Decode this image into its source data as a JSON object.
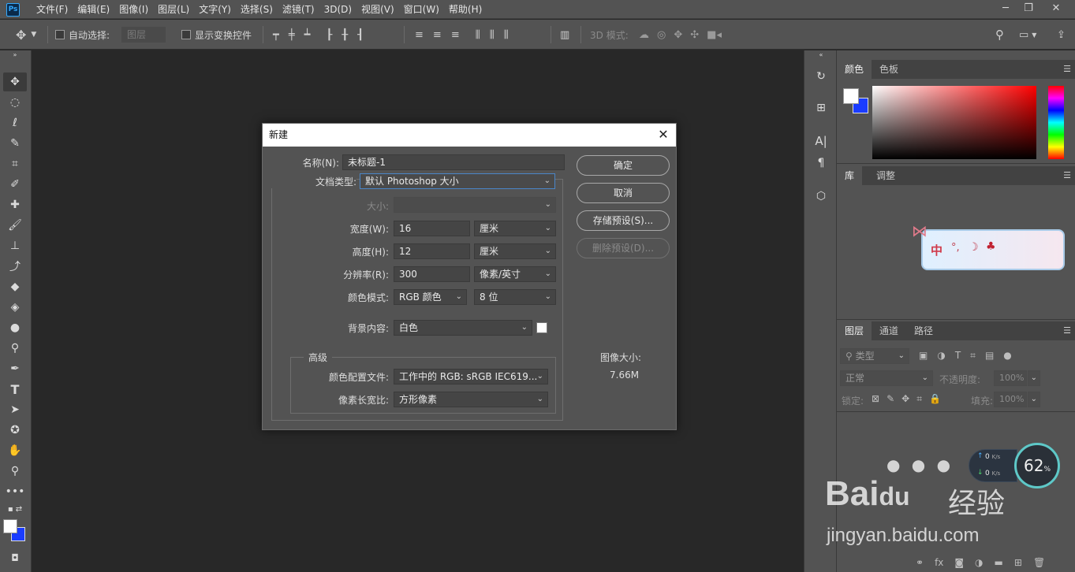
{
  "app": {
    "logo_text": "Ps"
  },
  "menu": [
    "文件(F)",
    "编辑(E)",
    "图像(I)",
    "图层(L)",
    "文字(Y)",
    "选择(S)",
    "滤镜(T)",
    "3D(D)",
    "视图(V)",
    "窗口(W)",
    "帮助(H)"
  ],
  "window_controls": {
    "minimize": "─",
    "restore": "❐",
    "close": "✕"
  },
  "options": {
    "auto_select_label": "自动选择:",
    "auto_select_target": "图层",
    "show_transform_label": "显示变换控件",
    "mode3d_label": "3D 模式:"
  },
  "right_tabs": {
    "color_tab": "颜色",
    "swatch_tab": "色板",
    "library_tab": "库",
    "adjust_tab": "调整",
    "layers_tab": "图层",
    "channels_tab": "通道",
    "paths_tab": "路径"
  },
  "layers": {
    "filter_kind": "类型",
    "blend_mode": "正常",
    "opacity_label": "不透明度:",
    "opacity_value": "100%",
    "lock_label": "锁定:",
    "fill_label": "填充:",
    "fill_value": "100%"
  },
  "ime": {
    "text": "中"
  },
  "dialog": {
    "title": "新建",
    "close": "✕",
    "name_label": "名称(N):",
    "name_value": "未标题-1",
    "doc_type_label": "文档类型:",
    "doc_type_value": "默认 Photoshop 大小",
    "size_label": "大小:",
    "width_label": "宽度(W):",
    "width_value": "16",
    "width_unit": "厘米",
    "height_label": "高度(H):",
    "height_value": "12",
    "height_unit": "厘米",
    "resolution_label": "分辨率(R):",
    "resolution_value": "300",
    "resolution_unit": "像素/英寸",
    "color_mode_label": "颜色模式:",
    "color_mode_value": "RGB 颜色",
    "bit_depth": "8 位",
    "bg_label": "背景内容:",
    "bg_value": "白色",
    "advanced_label": "高级",
    "profile_label": "颜色配置文件:",
    "profile_value": "工作中的 RGB: sRGB IEC619...",
    "aspect_label": "像素长宽比:",
    "aspect_value": "方形像素",
    "ok": "确定",
    "cancel": "取消",
    "save_preset": "存储预设(S)...",
    "delete_preset": "删除预设(D)...",
    "image_size_label": "图像大小:",
    "image_size_value": "7.66M"
  },
  "network": {
    "up": "0",
    "down": "0",
    "unit": "K/s",
    "percent": "62",
    "percent_sign": "%"
  },
  "watermark": {
    "brand": "Bai",
    "brand2": "du",
    "cn": "经验",
    "url": "jingyan.baidu.com"
  },
  "colors": {
    "accent": "#31a8ff",
    "panel": "#535353",
    "canvas": "#282828",
    "background_swatch": "#1a3cff"
  }
}
